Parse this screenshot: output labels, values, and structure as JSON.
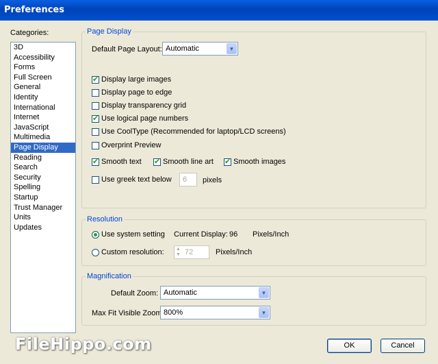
{
  "window": {
    "title": "Preferences"
  },
  "categories": {
    "label": "Categories:",
    "items": [
      "3D",
      "Accessibility",
      "Forms",
      "Full Screen",
      "General",
      "Identity",
      "International",
      "Internet",
      "JavaScript",
      "Multimedia",
      "Page Display",
      "Reading",
      "Search",
      "Security",
      "Spelling",
      "Startup",
      "Trust Manager",
      "Units",
      "Updates"
    ],
    "selected": "Page Display"
  },
  "page_display": {
    "legend": "Page Display",
    "layout_label": "Default Page Layout:",
    "layout_value": "Automatic",
    "options": {
      "large_images": {
        "label": "Display large images",
        "checked": true
      },
      "page_to_edge": {
        "label": "Display page to edge",
        "checked": false
      },
      "transparency_grid": {
        "label": "Display transparency grid",
        "checked": false
      },
      "logical_numbers": {
        "label": "Use logical page numbers",
        "checked": true
      },
      "cooltype": {
        "label": "Use CoolType (Recommended for laptop/LCD screens)",
        "checked": false
      },
      "overprint": {
        "label": "Overprint Preview",
        "checked": false
      },
      "smooth_text": {
        "label": "Smooth text",
        "checked": true
      },
      "smooth_line_art": {
        "label": "Smooth line art",
        "checked": true
      },
      "smooth_images": {
        "label": "Smooth images",
        "checked": true
      },
      "greek_text": {
        "label": "Use greek text below",
        "checked": false
      }
    },
    "greek_value": "6",
    "greek_unit": "pixels"
  },
  "resolution": {
    "legend": "Resolution",
    "system_label": "Use system setting",
    "current_label": "Current Display:",
    "current_value": "96",
    "current_unit": "Pixels/Inch",
    "custom_label": "Custom resolution:",
    "custom_value": "72",
    "custom_unit": "Pixels/Inch"
  },
  "magnification": {
    "legend": "Magnification",
    "zoom_label": "Default Zoom:",
    "zoom_value": "Automatic",
    "max_label": "Max Fit Visible Zoom:",
    "max_value": "800%"
  },
  "buttons": {
    "ok": "OK",
    "cancel": "Cancel"
  },
  "watermark": "FileHippo.com"
}
